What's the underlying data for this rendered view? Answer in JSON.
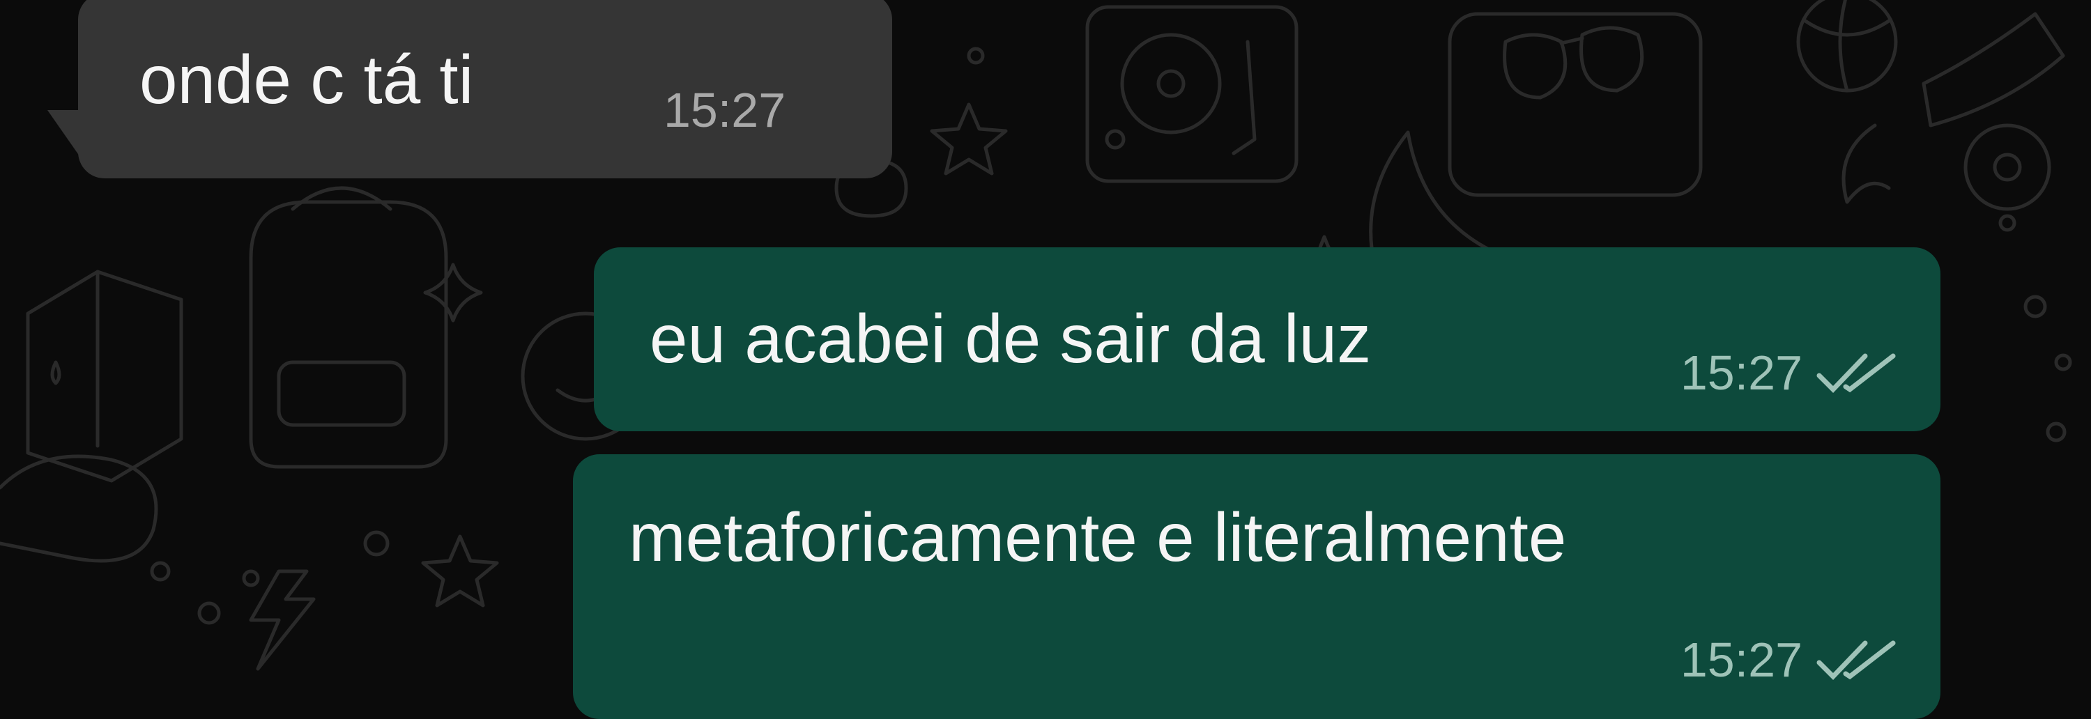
{
  "colors": {
    "background": "#0b0b0b",
    "incoming_bubble": "#353535",
    "outgoing_bubble": "#0d4a3c",
    "tick": "#9fc3b8"
  },
  "messages": [
    {
      "direction": "incoming",
      "text": "onde c tá ti",
      "time": "15:27"
    },
    {
      "direction": "outgoing",
      "text": "eu acabei de sair da luz",
      "time": "15:27",
      "status_icon": "double-check-icon"
    },
    {
      "direction": "outgoing",
      "text": "metaforicamente e literalmente",
      "time": "15:27",
      "status_icon": "double-check-icon"
    }
  ]
}
